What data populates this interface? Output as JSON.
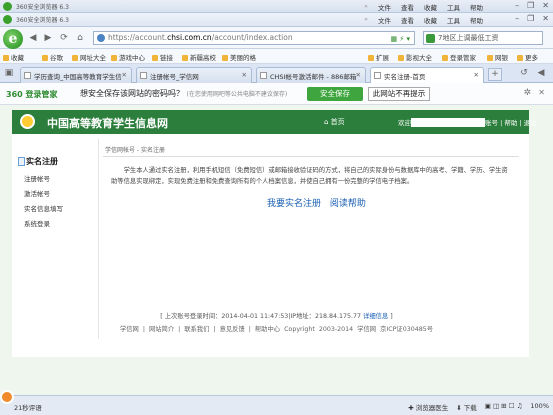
{
  "browser": {
    "window_title_1": "360安全浏览器 6.3",
    "window_title_2": "360安全浏览器 6.3",
    "menu": [
      "文件",
      "查看",
      "收藏",
      "工具",
      "帮助"
    ],
    "address": {
      "prefix": "https://account.",
      "domain": "chsi.com.cn",
      "path": "/account/index.action"
    },
    "search_placeholder": "7地区上调最低工资",
    "favorites": [
      "收藏",
      "谷歌",
      "网址大全",
      "游戏中心",
      "链接",
      "新疆高校",
      "美丽的格",
      "扩展",
      "影视大全",
      "登录管家",
      "网银",
      "更多"
    ],
    "tabs": [
      {
        "label": "学历查询_中国高等教育学生信",
        "active": false
      },
      {
        "label": "注册帐号_学信网",
        "active": false
      },
      {
        "label": "CHSI帐号激活邮件 - 886邮箱",
        "active": false
      },
      {
        "label": "实名注册-首页",
        "active": true
      }
    ],
    "tab_new": "+"
  },
  "password_bar": {
    "brand": "360 登录管家",
    "question": "想安全保存该网站的密码吗？",
    "hint": "(在您使用网吧等公共电脑不建议保存)",
    "save_label": "安全保存",
    "never_label": "此网站不再提示"
  },
  "site": {
    "name": "中国高等教育学生信息网",
    "home_label": "首页",
    "welcome": "欢迎",
    "account_label": "账号",
    "help_label": "帮助",
    "logout_label": "退出"
  },
  "sidebar": {
    "title": "实名注册",
    "items": [
      "注册帐号",
      "激活帐号",
      "实名信息填写",
      "系统登录"
    ]
  },
  "main": {
    "breadcrumb": "学信网帐号 - 实名注册",
    "intro": "学生本人通过实名注册，利用手机短信（免费短信）或邮箱接收验证码的方式，将自己的实际身份与数据库中的高考、学籍、学历、学生资助等信息实现绑定，实现免费注册和免费查询所有的个人档案信息，并使自己拥有一份完整的学信电子档案。",
    "register_link": "我要实名注册",
    "help_link": "阅读帮助"
  },
  "footer": {
    "last_login": "[ 上次账号登录时间：2014-04-01 11:47:53|IP地址：218.84.175.77",
    "detail_link": "详细信息",
    "last_login_end": "]",
    "links_line": "学信网 | 网站简介 | 联系我们 | 意见反馈 | 帮助中心 Copyright 2003-2014 学信网 京ICP证030485号"
  },
  "statusbar": {
    "left": "21秒评语",
    "items": [
      "浏览器医生",
      "下载",
      "100%"
    ]
  }
}
